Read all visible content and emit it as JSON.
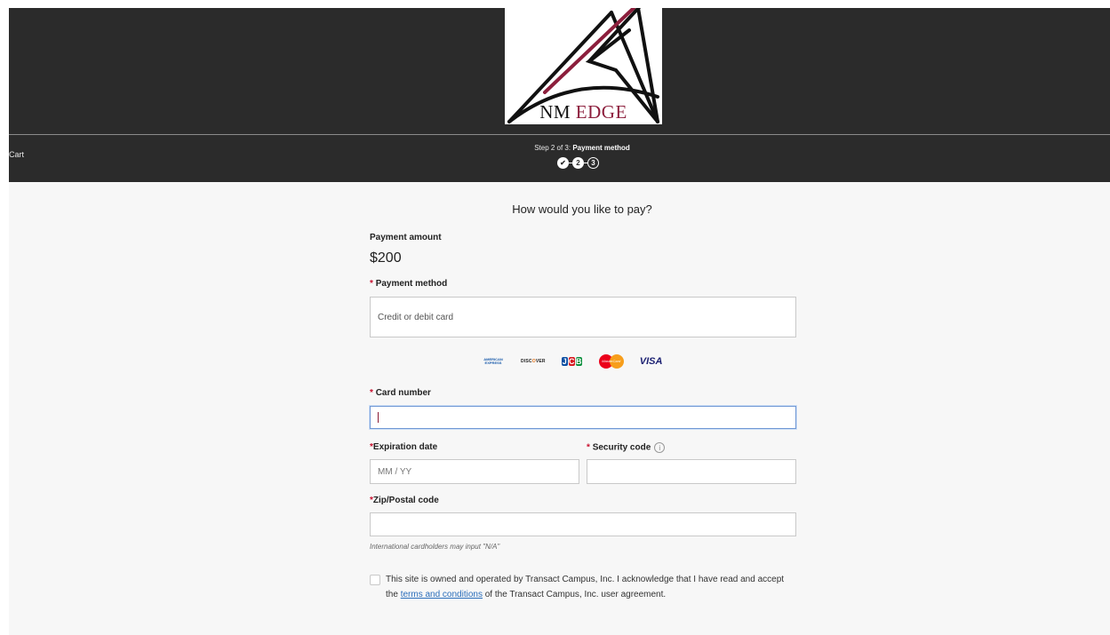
{
  "logo": {
    "text_nm": "NM",
    "text_edge": "EDGE"
  },
  "nav": {
    "cart_label": "Cart"
  },
  "stepper": {
    "prefix": "Step 2 of 3: ",
    "current_label": "Payment method",
    "steps": [
      {
        "label": "✔",
        "state": "done"
      },
      {
        "label": "2",
        "state": "current"
      },
      {
        "label": "3",
        "state": "future"
      }
    ]
  },
  "page": {
    "heading": "How would you like to pay?"
  },
  "payment": {
    "amount_label": "Payment amount",
    "amount_value": "$200",
    "method_required": "*",
    "method_label": "Payment method",
    "method_value": "Credit or debit card",
    "card_logos": {
      "amex": "AMERICAN EXPRESS",
      "discover_a": "DISC",
      "discover_b": "O",
      "discover_c": "VER",
      "jcb_j": "J",
      "jcb_c": "C",
      "jcb_b": "B",
      "mastercard": "MasterCard",
      "visa": "VISA"
    },
    "card_number_required": "*",
    "card_number_label": "Card number",
    "card_number_value": "",
    "expiration_required": "*",
    "expiration_label": "Expiration date",
    "expiration_placeholder": "MM / YY",
    "security_required": "*",
    "security_label": "Security code",
    "security_info": "i",
    "zip_required": "*",
    "zip_label": "Zip/Postal code",
    "zip_hint": "International cardholders may input \"N/A\"",
    "agreement_prefix": "This site is owned and operated by Transact Campus, Inc. I acknowledge that I have read and accept the ",
    "agreement_link": "terms and conditions",
    "agreement_suffix": " of the Transact Campus, Inc. user agreement."
  },
  "colors": {
    "header_bg": "#2b2b2b",
    "page_bg": "#f7f7f7",
    "required": "#c8102e",
    "link": "#2a6ebb",
    "logo_accent": "#8c1e3c",
    "focus_border": "#6f97d4"
  }
}
